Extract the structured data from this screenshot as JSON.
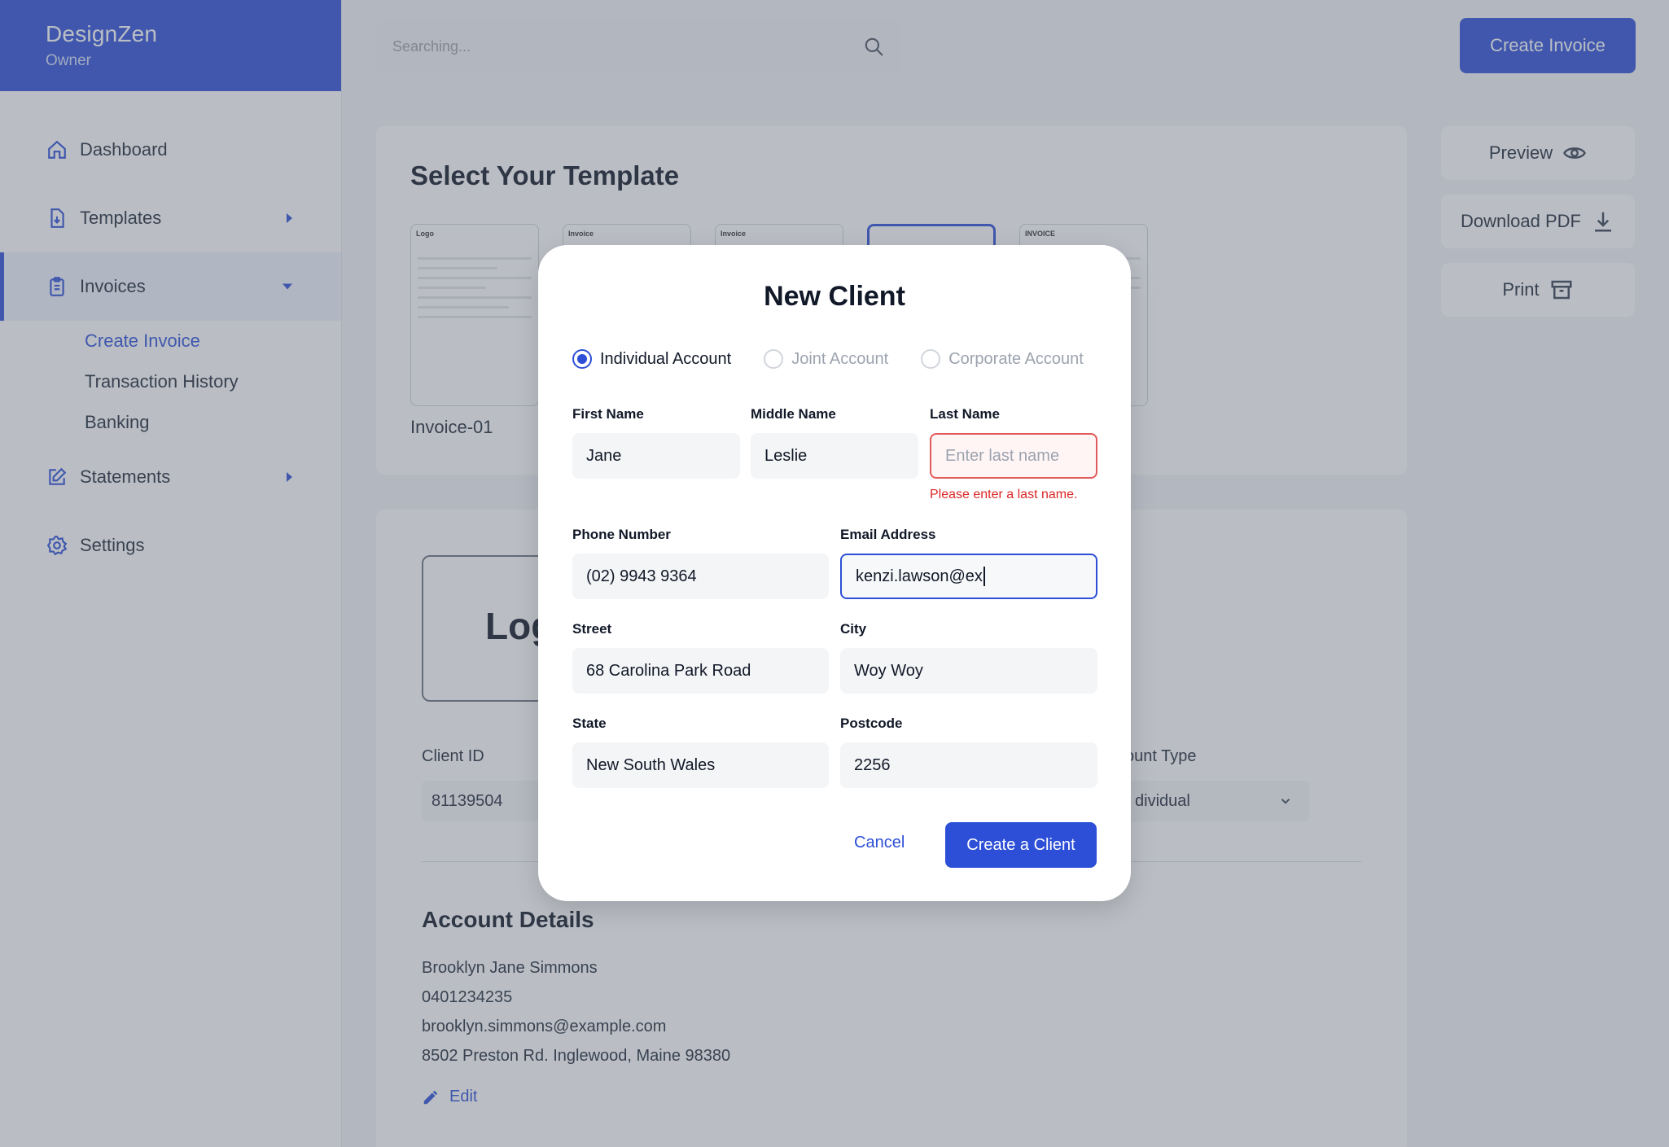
{
  "brand": {
    "name": "DesignZen",
    "role": "Owner"
  },
  "sidebar": {
    "items": [
      {
        "label": "Dashboard",
        "icon": "home-icon"
      },
      {
        "label": "Templates",
        "icon": "file-download-icon"
      },
      {
        "label": "Invoices",
        "icon": "clipboard-icon"
      },
      {
        "label": "Statements",
        "icon": "edit-square-icon"
      },
      {
        "label": "Settings",
        "icon": "gear-icon"
      }
    ],
    "invoice_sub": [
      "Create Invoice",
      "Transaction History",
      "Banking"
    ]
  },
  "search": {
    "placeholder": "Searching..."
  },
  "header": {
    "create_invoice": "Create Invoice"
  },
  "actions": {
    "preview": "Preview",
    "download": "Download PDF",
    "print": "Print"
  },
  "templates": {
    "title": "Select Your Template",
    "thumbs": [
      "Logo",
      "Invoice",
      "Invoice",
      "",
      "INVOICE"
    ],
    "first_label": "Invoice-01"
  },
  "invoice": {
    "logo_text": "Log",
    "client_id_label": "Client ID",
    "client_id": "81139504",
    "account_type_label": "ount Type",
    "account_type_value": "dividual",
    "account_details_title": "Account Details",
    "account_lines": [
      "Brooklyn Jane Simmons",
      "0401234235",
      "brooklyn.simmons@example.com",
      "8502 Preston Rd. Inglewood, Maine 98380"
    ],
    "edit_label": "Edit"
  },
  "modal": {
    "title": "New Client",
    "account_types": [
      "Individual Account",
      "Joint Account",
      "Corporate Account"
    ],
    "first_name_label": "First Name",
    "first_name": "Jane",
    "middle_name_label": "Middle Name",
    "middle_name": "Leslie",
    "last_name_label": "Last Name",
    "last_name_placeholder": "Enter last name",
    "last_name_error": "Please enter a last name.",
    "phone_label": "Phone Number",
    "phone": "(02) 9943 9364",
    "email_label": "Email Address",
    "email": "kenzi.lawson@ex",
    "street_label": "Street",
    "street": "68 Carolina Park Road",
    "city_label": "City",
    "city": "Woy Woy",
    "state_label": "State",
    "state": "New South Wales",
    "postcode_label": "Postcode",
    "postcode": "2256",
    "cancel": "Cancel",
    "create": "Create a Client"
  },
  "colors": {
    "primary": "#2d4fd7",
    "error": "#dc2626"
  }
}
